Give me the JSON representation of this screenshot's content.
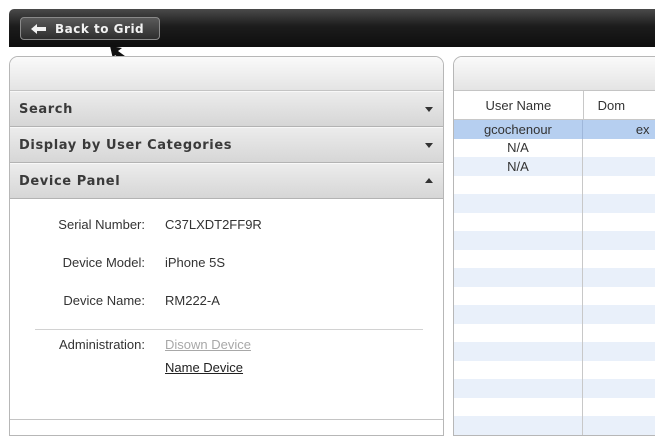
{
  "toolbar": {
    "back_label": "Back to Grid",
    "back_icon": "arrow-left-icon"
  },
  "accordion": {
    "search_label": "Search",
    "categories_label": "Display by User Categories",
    "device_panel_label": "Device Panel"
  },
  "device": {
    "serial_label": "Serial Number:",
    "serial_value": "C37LXDT2FF9R",
    "model_label": "Device Model:",
    "model_value": "iPhone 5S",
    "name_label": "Device Name:",
    "name_value": "RM222-A",
    "admin_label": "Administration:",
    "disown_link": "Disown Device",
    "name_link": "Name Device"
  },
  "grid": {
    "columns": [
      "User Name",
      "Dom"
    ],
    "rows": [
      [
        "gcochenour",
        "ex"
      ],
      [
        "N/A",
        ""
      ],
      [
        "N/A",
        ""
      ],
      [
        "",
        ""
      ],
      [
        "",
        ""
      ],
      [
        "",
        ""
      ],
      [
        "",
        ""
      ],
      [
        "",
        ""
      ],
      [
        "",
        ""
      ],
      [
        "",
        ""
      ],
      [
        "",
        ""
      ],
      [
        "",
        ""
      ],
      [
        "",
        ""
      ],
      [
        "",
        ""
      ],
      [
        "",
        ""
      ],
      [
        "",
        ""
      ],
      [
        "",
        ""
      ]
    ]
  },
  "colors": {
    "toolbar": "#111111",
    "selected_row": "#b6cff0",
    "alt_row": "#e9f0fa",
    "disabled_link": "#a8a8a8"
  }
}
